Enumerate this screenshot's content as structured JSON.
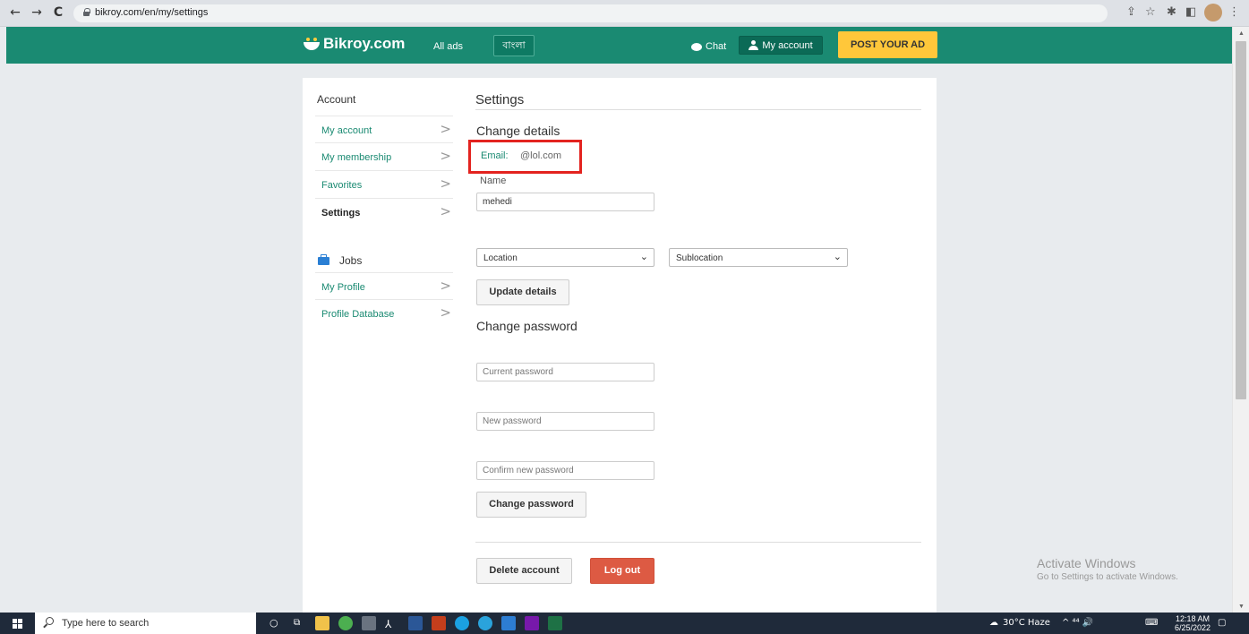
{
  "browser": {
    "url": "bikroy.com/en/my/settings",
    "nav": {
      "back": "←",
      "forward": "→",
      "reload": "C"
    },
    "toolbar_icons": [
      "share-icon",
      "star-icon",
      "extensions-icon",
      "sidepanel-icon",
      "profile-avatar",
      "menu-icon"
    ]
  },
  "header": {
    "brand": "Bikroy.com",
    "all_ads": "All ads",
    "language": "বাংলা",
    "chat": "Chat",
    "my_account": "My account",
    "post_ad": "POST YOUR AD"
  },
  "sidebar": {
    "account_title": "Account",
    "items": [
      {
        "label": "My account",
        "active": false
      },
      {
        "label": "My membership",
        "active": false
      },
      {
        "label": "Favorites",
        "active": false
      },
      {
        "label": "Settings",
        "active": true
      }
    ],
    "jobs_title": "Jobs",
    "jobs_items": [
      {
        "label": "My Profile"
      },
      {
        "label": "Profile Database"
      }
    ]
  },
  "settings": {
    "title": "Settings",
    "change_details": "Change details",
    "email_label": "Email:",
    "email_value": "@lol.com",
    "name_label": "Name",
    "name_value": "mehedi",
    "location": "Location",
    "sublocation": "Sublocation",
    "update_button": "Update details",
    "change_password": "Change password",
    "current_password_placeholder": "Current password",
    "new_password_placeholder": "New password",
    "confirm_password_placeholder": "Confirm new password",
    "change_password_button": "Change password",
    "delete_account": "Delete account",
    "log_out": "Log out"
  },
  "watermark": {
    "line1": "Activate Windows",
    "line2": "Go to Settings to activate Windows."
  },
  "taskbar": {
    "search_placeholder": "Type here to search",
    "weather": "30°C  Haze",
    "time": "12:18 AM",
    "date": "6/25/2022",
    "tray_text": "^  ⁴⁴  🔊"
  },
  "colors": {
    "brand_green": "#1a8a72",
    "post_ad_yellow": "#ffc73a",
    "logout_red": "#dd5a43",
    "highlight_red": "#e3231f"
  }
}
